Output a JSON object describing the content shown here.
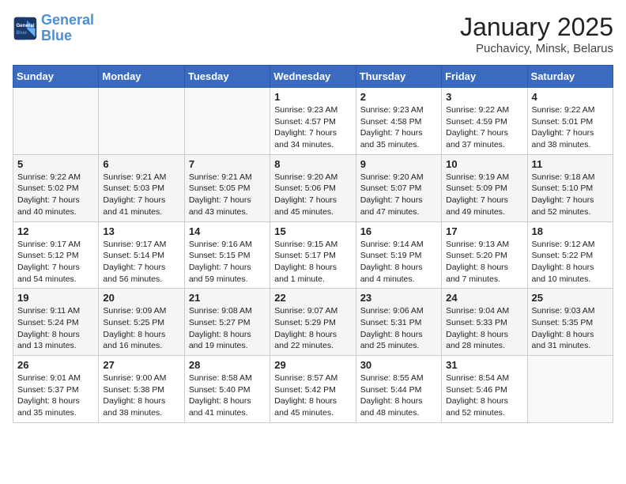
{
  "logo": {
    "line1": "General",
    "line2": "Blue"
  },
  "title": "January 2025",
  "location": "Puchavicy, Minsk, Belarus",
  "weekdays": [
    "Sunday",
    "Monday",
    "Tuesday",
    "Wednesday",
    "Thursday",
    "Friday",
    "Saturday"
  ],
  "weeks": [
    [
      {
        "day": "",
        "sunrise": "",
        "sunset": "",
        "daylight": ""
      },
      {
        "day": "",
        "sunrise": "",
        "sunset": "",
        "daylight": ""
      },
      {
        "day": "",
        "sunrise": "",
        "sunset": "",
        "daylight": ""
      },
      {
        "day": "1",
        "sunrise": "Sunrise: 9:23 AM",
        "sunset": "Sunset: 4:57 PM",
        "daylight": "Daylight: 7 hours and 34 minutes."
      },
      {
        "day": "2",
        "sunrise": "Sunrise: 9:23 AM",
        "sunset": "Sunset: 4:58 PM",
        "daylight": "Daylight: 7 hours and 35 minutes."
      },
      {
        "day": "3",
        "sunrise": "Sunrise: 9:22 AM",
        "sunset": "Sunset: 4:59 PM",
        "daylight": "Daylight: 7 hours and 37 minutes."
      },
      {
        "day": "4",
        "sunrise": "Sunrise: 9:22 AM",
        "sunset": "Sunset: 5:01 PM",
        "daylight": "Daylight: 7 hours and 38 minutes."
      }
    ],
    [
      {
        "day": "5",
        "sunrise": "Sunrise: 9:22 AM",
        "sunset": "Sunset: 5:02 PM",
        "daylight": "Daylight: 7 hours and 40 minutes."
      },
      {
        "day": "6",
        "sunrise": "Sunrise: 9:21 AM",
        "sunset": "Sunset: 5:03 PM",
        "daylight": "Daylight: 7 hours and 41 minutes."
      },
      {
        "day": "7",
        "sunrise": "Sunrise: 9:21 AM",
        "sunset": "Sunset: 5:05 PM",
        "daylight": "Daylight: 7 hours and 43 minutes."
      },
      {
        "day": "8",
        "sunrise": "Sunrise: 9:20 AM",
        "sunset": "Sunset: 5:06 PM",
        "daylight": "Daylight: 7 hours and 45 minutes."
      },
      {
        "day": "9",
        "sunrise": "Sunrise: 9:20 AM",
        "sunset": "Sunset: 5:07 PM",
        "daylight": "Daylight: 7 hours and 47 minutes."
      },
      {
        "day": "10",
        "sunrise": "Sunrise: 9:19 AM",
        "sunset": "Sunset: 5:09 PM",
        "daylight": "Daylight: 7 hours and 49 minutes."
      },
      {
        "day": "11",
        "sunrise": "Sunrise: 9:18 AM",
        "sunset": "Sunset: 5:10 PM",
        "daylight": "Daylight: 7 hours and 52 minutes."
      }
    ],
    [
      {
        "day": "12",
        "sunrise": "Sunrise: 9:17 AM",
        "sunset": "Sunset: 5:12 PM",
        "daylight": "Daylight: 7 hours and 54 minutes."
      },
      {
        "day": "13",
        "sunrise": "Sunrise: 9:17 AM",
        "sunset": "Sunset: 5:14 PM",
        "daylight": "Daylight: 7 hours and 56 minutes."
      },
      {
        "day": "14",
        "sunrise": "Sunrise: 9:16 AM",
        "sunset": "Sunset: 5:15 PM",
        "daylight": "Daylight: 7 hours and 59 minutes."
      },
      {
        "day": "15",
        "sunrise": "Sunrise: 9:15 AM",
        "sunset": "Sunset: 5:17 PM",
        "daylight": "Daylight: 8 hours and 1 minute."
      },
      {
        "day": "16",
        "sunrise": "Sunrise: 9:14 AM",
        "sunset": "Sunset: 5:19 PM",
        "daylight": "Daylight: 8 hours and 4 minutes."
      },
      {
        "day": "17",
        "sunrise": "Sunrise: 9:13 AM",
        "sunset": "Sunset: 5:20 PM",
        "daylight": "Daylight: 8 hours and 7 minutes."
      },
      {
        "day": "18",
        "sunrise": "Sunrise: 9:12 AM",
        "sunset": "Sunset: 5:22 PM",
        "daylight": "Daylight: 8 hours and 10 minutes."
      }
    ],
    [
      {
        "day": "19",
        "sunrise": "Sunrise: 9:11 AM",
        "sunset": "Sunset: 5:24 PM",
        "daylight": "Daylight: 8 hours and 13 minutes."
      },
      {
        "day": "20",
        "sunrise": "Sunrise: 9:09 AM",
        "sunset": "Sunset: 5:25 PM",
        "daylight": "Daylight: 8 hours and 16 minutes."
      },
      {
        "day": "21",
        "sunrise": "Sunrise: 9:08 AM",
        "sunset": "Sunset: 5:27 PM",
        "daylight": "Daylight: 8 hours and 19 minutes."
      },
      {
        "day": "22",
        "sunrise": "Sunrise: 9:07 AM",
        "sunset": "Sunset: 5:29 PM",
        "daylight": "Daylight: 8 hours and 22 minutes."
      },
      {
        "day": "23",
        "sunrise": "Sunrise: 9:06 AM",
        "sunset": "Sunset: 5:31 PM",
        "daylight": "Daylight: 8 hours and 25 minutes."
      },
      {
        "day": "24",
        "sunrise": "Sunrise: 9:04 AM",
        "sunset": "Sunset: 5:33 PM",
        "daylight": "Daylight: 8 hours and 28 minutes."
      },
      {
        "day": "25",
        "sunrise": "Sunrise: 9:03 AM",
        "sunset": "Sunset: 5:35 PM",
        "daylight": "Daylight: 8 hours and 31 minutes."
      }
    ],
    [
      {
        "day": "26",
        "sunrise": "Sunrise: 9:01 AM",
        "sunset": "Sunset: 5:37 PM",
        "daylight": "Daylight: 8 hours and 35 minutes."
      },
      {
        "day": "27",
        "sunrise": "Sunrise: 9:00 AM",
        "sunset": "Sunset: 5:38 PM",
        "daylight": "Daylight: 8 hours and 38 minutes."
      },
      {
        "day": "28",
        "sunrise": "Sunrise: 8:58 AM",
        "sunset": "Sunset: 5:40 PM",
        "daylight": "Daylight: 8 hours and 41 minutes."
      },
      {
        "day": "29",
        "sunrise": "Sunrise: 8:57 AM",
        "sunset": "Sunset: 5:42 PM",
        "daylight": "Daylight: 8 hours and 45 minutes."
      },
      {
        "day": "30",
        "sunrise": "Sunrise: 8:55 AM",
        "sunset": "Sunset: 5:44 PM",
        "daylight": "Daylight: 8 hours and 48 minutes."
      },
      {
        "day": "31",
        "sunrise": "Sunrise: 8:54 AM",
        "sunset": "Sunset: 5:46 PM",
        "daylight": "Daylight: 8 hours and 52 minutes."
      },
      {
        "day": "",
        "sunrise": "",
        "sunset": "",
        "daylight": ""
      }
    ]
  ]
}
